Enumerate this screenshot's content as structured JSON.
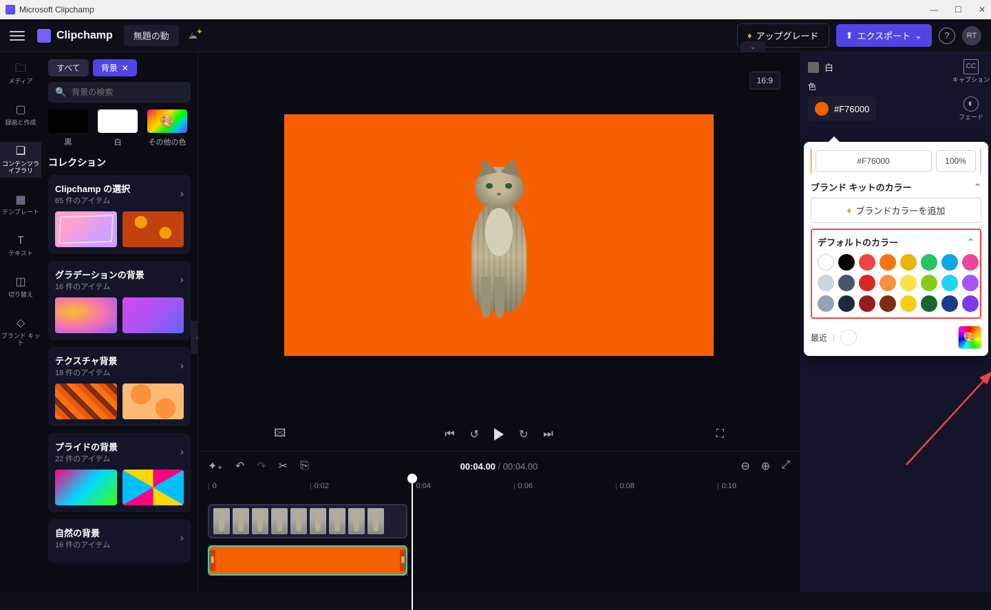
{
  "window_title": "Microsoft Clipchamp",
  "brand_name": "Clipchamp",
  "project_name": "無題の動",
  "topbar": {
    "upgrade": "アップグレード",
    "export": "エクスポート",
    "avatar": "RT"
  },
  "nav": {
    "media": "メディア",
    "record": "録画と作成",
    "library": "コンテンツライブラリ",
    "templates": "テンプレート",
    "text": "テキスト",
    "transitions": "切り替え",
    "brandkit": "ブランド キット"
  },
  "panel": {
    "chip_all": "すべて",
    "chip_bg": "背景",
    "search_placeholder": "背景の検索",
    "colors": {
      "black": "黒",
      "white": "白",
      "other": "その他の色"
    },
    "collections_label": "コレクション",
    "collections": [
      {
        "name": "Clipchamp の選択",
        "sub": "65 件のアイテム"
      },
      {
        "name": "グラデーションの背景",
        "sub": "16 件のアイテム"
      },
      {
        "name": "テクスチャ背景",
        "sub": "18 件のアイテム"
      },
      {
        "name": "プライドの背景",
        "sub": "22 件のアイテム"
      },
      {
        "name": "自然の背景",
        "sub": "16 件のアイテム"
      }
    ]
  },
  "preview": {
    "aspect": "16:9"
  },
  "timeline": {
    "current": "00:04.00",
    "total": "00:04.00",
    "marks": [
      "0",
      "0:02",
      "0:04",
      "0:06",
      "0:08",
      "0:10"
    ]
  },
  "props": {
    "head": "白",
    "color_label": "色",
    "color_value": "#F76000"
  },
  "popover": {
    "hex": "#F76000",
    "opacity": "100%",
    "brand_section": "ブランド キットのカラー",
    "brand_button": "ブランドカラーを追加",
    "default_section": "デフォルトのカラー",
    "recent_label": "最近",
    "default_colors": [
      "#ffffff",
      "#000000",
      "#ef4444",
      "#f97316",
      "#eab308",
      "#22c55e",
      "#0ea5e9",
      "#ec4899",
      "#cbd5e1",
      "#475569",
      "#dc2626",
      "#fb923c",
      "#fde047",
      "#84cc16",
      "#22d3ee",
      "#a855f7",
      "#94a3b8",
      "#1e293b",
      "#991b1b",
      "#7c2d12",
      "#facc15",
      "#166534",
      "#1e3a8a",
      "#7c3aed"
    ]
  },
  "right_tabs": {
    "captions": "キャプション",
    "fade": "フェード"
  }
}
